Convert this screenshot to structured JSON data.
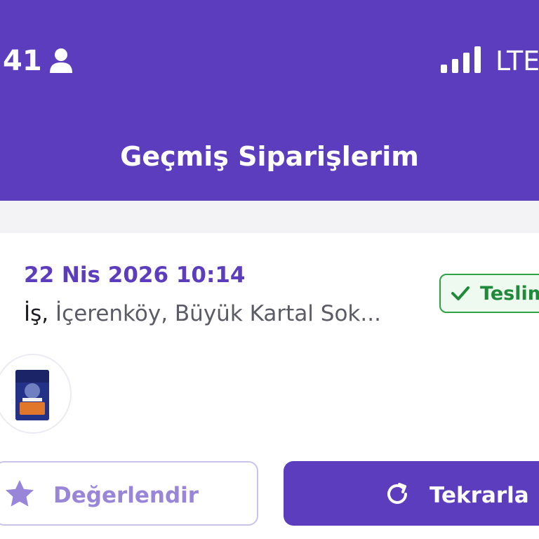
{
  "status_bar": {
    "time": "41",
    "network": "LTE",
    "icons": [
      "person-icon",
      "signal-icon"
    ]
  },
  "header": {
    "title": "Geçmiş Siparişlerim"
  },
  "order": {
    "date": "22 Nis 2026 10:14",
    "address_label": "İş,",
    "address_text": " İçerenköy, Büyük Kartal Sok...",
    "status": "Teslim",
    "status_icon": "check-icon",
    "product_icon": "product-image"
  },
  "actions": {
    "rate_label": "Değerlendir",
    "rate_icon": "star-icon",
    "reorder_label": "Tekrarla",
    "reorder_icon": "refresh-icon"
  },
  "colors": {
    "brand": "#5c3dbd",
    "status_green": "#1f8a3a",
    "rate_accent": "#9a86d8"
  }
}
